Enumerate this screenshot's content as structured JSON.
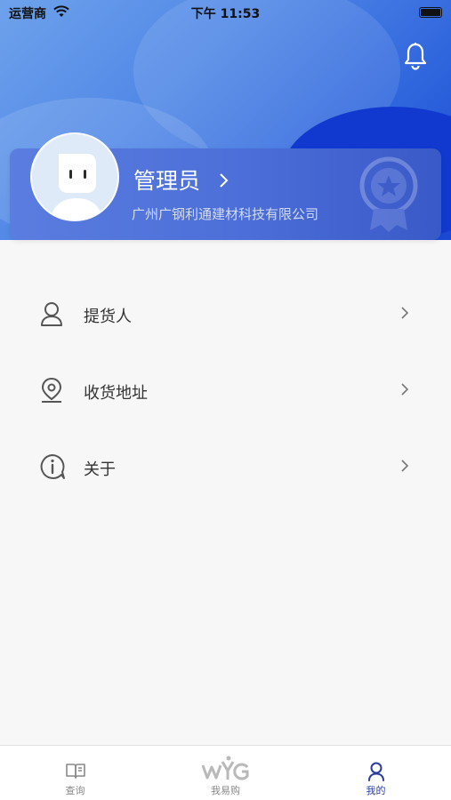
{
  "status_bar": {
    "carrier": "运营商",
    "time": "下午 11:53"
  },
  "profile": {
    "name": "管理员",
    "company": "广州广钢利通建材科技有限公司"
  },
  "menu": [
    {
      "label": "提货人",
      "icon": "person-icon"
    },
    {
      "label": "收货地址",
      "icon": "location-pin-icon"
    },
    {
      "label": "关于",
      "icon": "info-icon"
    }
  ],
  "tabbar": {
    "tabs": [
      {
        "label": "查询",
        "icon": "book-icon",
        "active": false
      },
      {
        "label": "我易购",
        "icon": "wyg-logo-icon",
        "active": false
      },
      {
        "label": "我的",
        "icon": "person-icon",
        "active": true
      }
    ]
  },
  "colors": {
    "header_gradient_start": "#6ea2ec",
    "header_gradient_end": "#1947d4",
    "card": "#4b6ed8",
    "active_tab": "#2b3ba3",
    "background": "#f7f7f8"
  }
}
